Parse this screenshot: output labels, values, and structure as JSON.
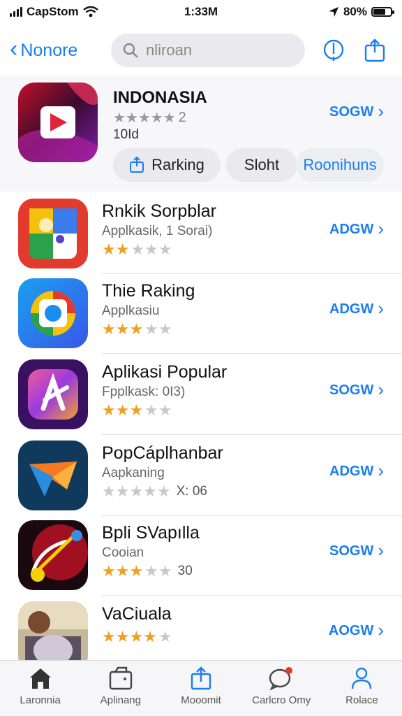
{
  "status_bar": {
    "carrier": "CapStom",
    "time": "1:33M",
    "battery": "80%"
  },
  "nav": {
    "back_label": "Nonore",
    "search_placeholder": "nliroan"
  },
  "featured": {
    "title": "INDONASIA",
    "rating_text": "2",
    "count": "10Id",
    "get_label": "SOGW",
    "pills": [
      "Rarking",
      "Sloht",
      "Roonihuns"
    ]
  },
  "apps": [
    {
      "name": "Rnkik Sorpblar",
      "subtitle": "Applkasik, 1 Sorai)",
      "rating": 2,
      "count": "",
      "get_label": "ADGW"
    },
    {
      "name": "Thie Raking",
      "subtitle": "Applkasiu",
      "rating": 3,
      "count": "",
      "get_label": "ADGW"
    },
    {
      "name": "Aplikasi Popular",
      "subtitle": "Fpplkask: 0I3)",
      "rating": 3,
      "count": "",
      "get_label": "SOGW"
    },
    {
      "name": "PopCáplhanbar",
      "subtitle": "Aapkaning",
      "rating": 0,
      "count": "X: 06",
      "get_label": "ADGW"
    },
    {
      "name": "Bpli SVapılla",
      "subtitle": "Cooian",
      "rating": 3,
      "count": "30",
      "get_label": "SOGW"
    },
    {
      "name": "VaCiuala",
      "subtitle": "",
      "rating": 4,
      "count": "",
      "get_label": "AOGW"
    }
  ],
  "tabs": [
    {
      "label": "Laronnia",
      "icon": "home-icon"
    },
    {
      "label": "Aplinang",
      "icon": "apps-icon"
    },
    {
      "label": "Mooomit",
      "icon": "share-icon"
    },
    {
      "label": "Carlcro Omy",
      "icon": "chat-icon"
    },
    {
      "label": "Rolace",
      "icon": "person-icon"
    }
  ],
  "colors": {
    "accent": "#1a7df0",
    "star_on": "#f0a020",
    "star_off": "#c8c8cc"
  }
}
